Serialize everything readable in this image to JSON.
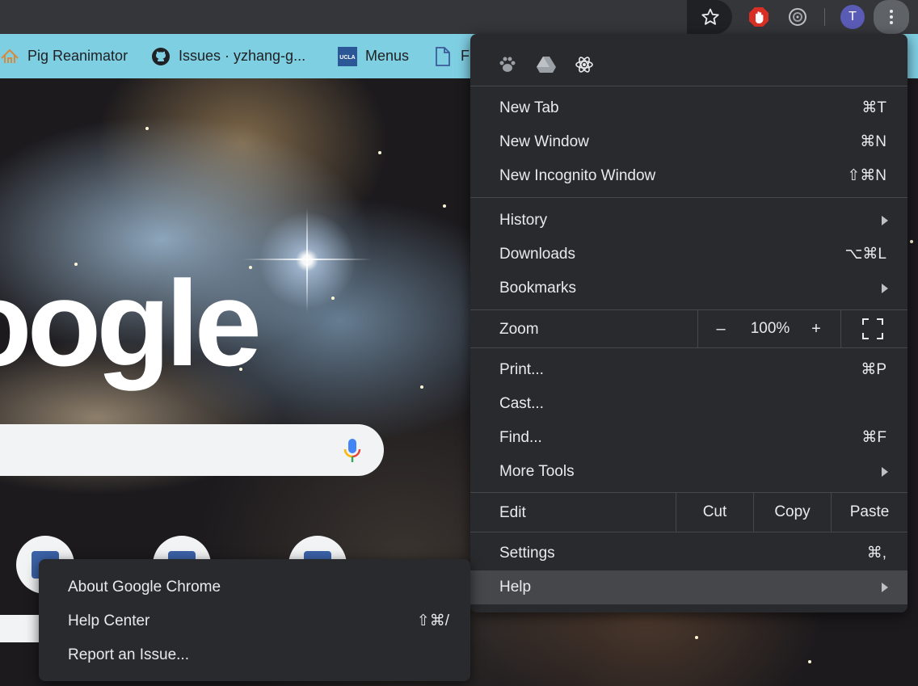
{
  "toolbar": {
    "avatar_initial": "T"
  },
  "bookmarks": [
    {
      "label": "Pig Reanimator",
      "icon": "pig-reanimator-icon"
    },
    {
      "label": "Issues · yzhang-g...",
      "icon": "github-icon"
    },
    {
      "label": "Menus",
      "icon": "ucla-icon",
      "icon_text": "UCLA"
    },
    {
      "label": "F",
      "icon": "document-icon"
    }
  ],
  "page": {
    "logo_text": "oogle"
  },
  "menu": {
    "extension_icons": [
      "paw-icon",
      "drive-icon",
      "react-icon"
    ],
    "new_tab": {
      "label": "New Tab",
      "shortcut": "⌘T"
    },
    "new_window": {
      "label": "New Window",
      "shortcut": "⌘N"
    },
    "new_incognito": {
      "label": "New Incognito Window",
      "shortcut": "⇧⌘N"
    },
    "history": {
      "label": "History"
    },
    "downloads": {
      "label": "Downloads",
      "shortcut": "⌥⌘L"
    },
    "bookmarks": {
      "label": "Bookmarks"
    },
    "zoom": {
      "label": "Zoom",
      "minus": "–",
      "value": "100%",
      "plus": "+"
    },
    "print": {
      "label": "Print...",
      "shortcut": "⌘P"
    },
    "cast": {
      "label": "Cast..."
    },
    "find": {
      "label": "Find...",
      "shortcut": "⌘F"
    },
    "more_tools": {
      "label": "More Tools"
    },
    "edit": {
      "label": "Edit",
      "cut": "Cut",
      "copy": "Copy",
      "paste": "Paste"
    },
    "settings": {
      "label": "Settings",
      "shortcut": "⌘,"
    },
    "help": {
      "label": "Help"
    }
  },
  "help_submenu": {
    "about": {
      "label": "About Google Chrome"
    },
    "help_center": {
      "label": "Help Center",
      "shortcut": "⇧⌘/"
    },
    "report": {
      "label": "Report an Issue..."
    }
  }
}
